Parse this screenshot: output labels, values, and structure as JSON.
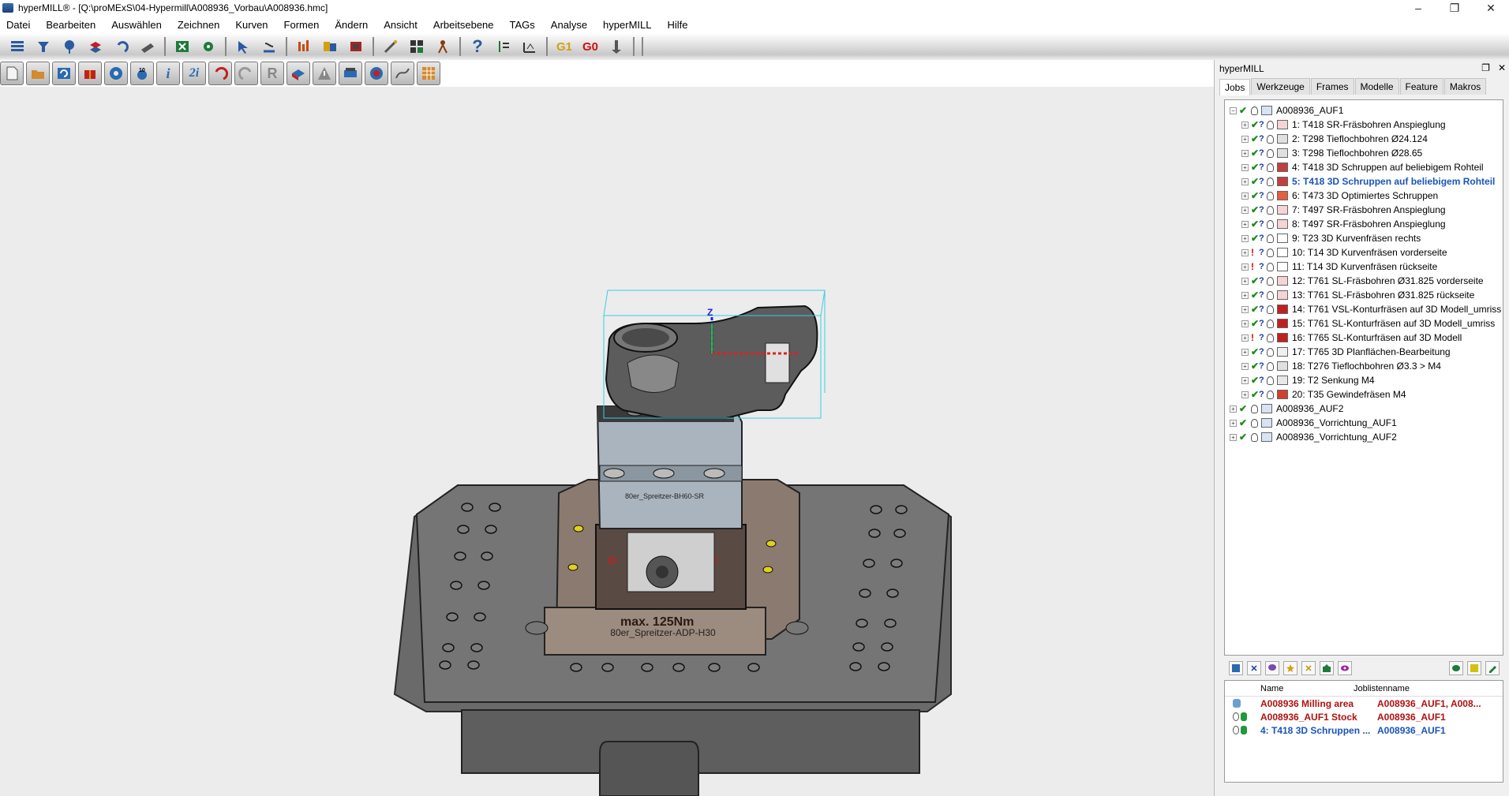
{
  "window": {
    "title": "hyperMILL® - [Q:\\proMExS\\04-Hypermill\\A008936_Vorbau\\A008936.hmc]",
    "minimize": "–",
    "maximize": "❐",
    "close": "✕"
  },
  "menu": [
    "Datei",
    "Bearbeiten",
    "Auswählen",
    "Zeichnen",
    "Kurven",
    "Formen",
    "Ändern",
    "Ansicht",
    "Arbeitsebene",
    "TAGs",
    "Analyse",
    "hyperMILL",
    "Hilfe"
  ],
  "toolbar1": {
    "icons": [
      "layers-icon",
      "tool-icon",
      "locate-icon",
      "stack-icon",
      "undo-arrow-icon",
      "cut-icon",
      "excel-icon",
      "settings-icon",
      "cursor-icon",
      "ruler-icon",
      "chart-icon",
      "boxes-icon",
      "measure-icon",
      "grid-icon",
      "figure-icon",
      "help-icon",
      "list-icon",
      "axis-icon",
      "g1-icon",
      "g0-icon",
      "spindle-icon"
    ],
    "texts": {
      "help": "?",
      "g1": "G1",
      "g0": "G0"
    }
  },
  "toolbar2": {
    "buttons": [
      "new-doc-icon",
      "folder-icon",
      "cycle-icon",
      "gift-icon",
      "gear-icon",
      "counter-icon",
      "info-icon",
      "info2-icon",
      "undo-icon",
      "redo-icon",
      "r-icon",
      "block-icon",
      "warning-icon",
      "hat-icon",
      "target-icon",
      "curve-icon",
      "table-icon"
    ],
    "texts": {
      "info": "i",
      "info2": "2i",
      "r": "R"
    }
  },
  "viewport": {
    "fixture_label_top": "80er_Spreitzer-BH60-SR",
    "fixture_label_bottom": "80er_Spreitzer-ADP-H30",
    "torque_label": "max. 125Nm",
    "open_label": "O",
    "close_label": "C",
    "axis_z": "Z",
    "colors": {
      "background": "#ececec",
      "plate": "#6d6d6d",
      "fixture": "#5a4a42",
      "part": "#5c5c5c",
      "bbox": "#36d0e0"
    }
  },
  "panel": {
    "title": "hyperMILL",
    "float_btn": "❐",
    "close_btn": "✕",
    "tabs": [
      "Jobs",
      "Werkzeuge",
      "Frames",
      "Modelle",
      "Feature",
      "Makros"
    ],
    "active_tab": "Jobs",
    "tree": [
      {
        "label": "A008936_AUF1",
        "level": 0,
        "exp": "−",
        "type": "list"
      },
      {
        "label": "1: T418 SR-Fräsbohren Anspieglung",
        "level": 1,
        "type": "drill"
      },
      {
        "label": "2: T298 Tieflochbohren Ø24.124",
        "level": 1,
        "type": "deep"
      },
      {
        "label": "3: T298 Tieflochbohren Ø28.65",
        "level": 1,
        "type": "deep"
      },
      {
        "label": "4: T418 3D Schruppen auf beliebigem Rohteil",
        "level": 1,
        "type": "rough"
      },
      {
        "label": "5: T418 3D Schruppen auf beliebigem Rohteil",
        "level": 1,
        "type": "rough",
        "highlight": true
      },
      {
        "label": "6: T473 3D Optimiertes Schruppen",
        "level": 1,
        "type": "opt"
      },
      {
        "label": "7: T497 SR-Fräsbohren Anspieglung",
        "level": 1,
        "type": "drill"
      },
      {
        "label": "8: T497 SR-Fräsbohren Anspieglung",
        "level": 1,
        "type": "drill"
      },
      {
        "label": "9: T23 3D Kurvenfräsen rechts",
        "level": 1,
        "type": "curve"
      },
      {
        "label": "10: T14 3D Kurvenfräsen vorderseite",
        "level": 1,
        "type": "curve",
        "warn": true
      },
      {
        "label": "11: T14 3D Kurvenfräsen rückseite",
        "level": 1,
        "type": "curve",
        "warn": true
      },
      {
        "label": "12: T761 SL-Fräsbohren Ø31.825 vorderseite",
        "level": 1,
        "type": "drill"
      },
      {
        "label": "13: T761 SL-Fräsbohren Ø31.825 rückseite",
        "level": 1,
        "type": "drill"
      },
      {
        "label": "14: T761 VSL-Konturfräsen auf 3D Modell_umriss",
        "level": 1,
        "type": "contour"
      },
      {
        "label": "15: T761 SL-Konturfräsen auf 3D Modell_umriss",
        "level": 1,
        "type": "contour"
      },
      {
        "label": "16: T765 SL-Konturfräsen auf 3D Modell",
        "level": 1,
        "type": "contour",
        "warn": true
      },
      {
        "label": "17: T765 3D Planflächen-Bearbeitung",
        "level": 1,
        "type": "plan"
      },
      {
        "label": "18: T276 Tieflochbohren Ø3.3 > M4",
        "level": 1,
        "type": "deep"
      },
      {
        "label": "19: T2 Senkung M4",
        "level": 1,
        "type": "sink"
      },
      {
        "label": "20: T35 Gewindefräsen M4",
        "level": 1,
        "type": "thread"
      },
      {
        "label": "A008936_AUF2",
        "level": 0,
        "exp": "+",
        "type": "list"
      },
      {
        "label": "A008936_Vorrichtung_AUF1",
        "level": 0,
        "exp": "+",
        "type": "list"
      },
      {
        "label": "A008936_Vorrichtung_AUF2",
        "level": 0,
        "exp": "+",
        "type": "list"
      }
    ],
    "panel_toolbar": [
      "new-job-icon",
      "delete-icon",
      "comment-icon",
      "star-icon",
      "x-mark-icon",
      "export-icon",
      "eye-icon",
      "db-icon",
      "edit-icon",
      "pencil-icon"
    ],
    "panel_toolbar_texts": {
      "delete": "✕",
      "x_mark": "✕"
    },
    "table": {
      "headers": [
        "Name",
        "Joblistenname"
      ],
      "rows": [
        {
          "name": "A008936 Milling area",
          "list": "A008936_AUF1, A008...",
          "color": "#b01010"
        },
        {
          "name": "A008936_AUF1 Stock",
          "list": "A008936_AUF1",
          "color": "#b01010"
        },
        {
          "name": "4: T418 3D Schruppen ...",
          "list": "A008936_AUF1",
          "color": "#1a54b8"
        }
      ]
    }
  }
}
